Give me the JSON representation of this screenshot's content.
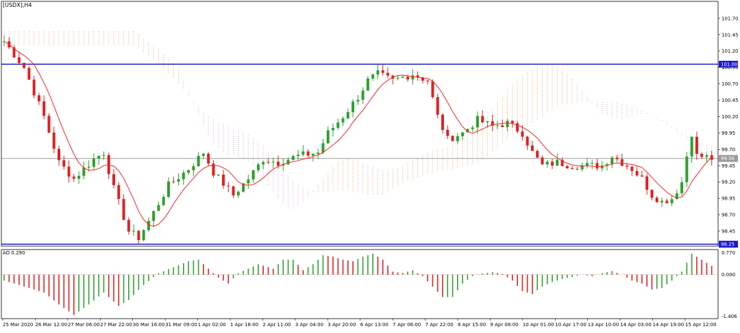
{
  "chart_data": {
    "type": "candlestick",
    "symbol_label": "[USDX],H4",
    "indicator_label": "AO 0.290",
    "price_axis": {
      "ticks": [
        "101.70",
        "101.45",
        "101.20",
        "100.95",
        "100.70",
        "100.45",
        "100.20",
        "99.95",
        "99.70",
        "99.45",
        "99.20",
        "98.95",
        "98.70",
        "98.45"
      ],
      "ylim": [
        98.22,
        101.96
      ]
    },
    "horizontal_levels": [
      {
        "value": 101.0,
        "label": "101.00",
        "color": "#1a1acc"
      },
      {
        "value": 98.25,
        "label": "98.25",
        "color": "#1a1acc"
      }
    ],
    "current_price": {
      "value": 99.56,
      "label": "99.56",
      "color": "#9a9a9a"
    },
    "ao_axis": {
      "ticks": [
        "0.770",
        "0.000",
        "-1.406"
      ],
      "ylim": [
        -1.406,
        0.77
      ]
    },
    "x_tick_labels": [
      "25 Mar 2020",
      "26 Mar 12:00",
      "27 Mar 06:00",
      "27 Mar 22:00",
      "30 Mar 16:00",
      "31 Mar 09:00",
      "1 Apr 02:00",
      "1 Apr 18:00",
      "2 Apr 11:00",
      "3 Apr 04:00",
      "3 Apr 20:00",
      "6 Apr 13:00",
      "7 Apr 06:00",
      "7 Apr 22:00",
      "8 Apr 15:00",
      "9 Apr 08:00",
      "10 Apr 01:00",
      "10 Apr 17:00",
      "13 Apr 10:00",
      "14 Apr 03:00",
      "14 Apr 19:00",
      "15 Apr 12:00"
    ],
    "close_path": [
      [
        0,
        101.35
      ],
      [
        4,
        100.95
      ],
      [
        8,
        100.2
      ],
      [
        11,
        99.5
      ],
      [
        14,
        99.25
      ],
      [
        18,
        99.55
      ],
      [
        20,
        99.65
      ],
      [
        22,
        99.1
      ],
      [
        25,
        98.45
      ],
      [
        27,
        98.35
      ],
      [
        29,
        98.6
      ],
      [
        33,
        99.15
      ],
      [
        37,
        99.4
      ],
      [
        40,
        99.65
      ],
      [
        42,
        99.35
      ],
      [
        46,
        99.0
      ],
      [
        49,
        99.25
      ],
      [
        52,
        99.55
      ],
      [
        55,
        99.5
      ],
      [
        59,
        99.6
      ],
      [
        63,
        99.65
      ],
      [
        65,
        99.95
      ],
      [
        68,
        100.2
      ],
      [
        71,
        100.5
      ],
      [
        73,
        100.75
      ],
      [
        75,
        100.85
      ],
      [
        78,
        100.75
      ],
      [
        82,
        100.85
      ],
      [
        85,
        100.75
      ],
      [
        87,
        100.2
      ],
      [
        89,
        99.85
      ],
      [
        92,
        99.95
      ],
      [
        95,
        100.15
      ],
      [
        98,
        100.05
      ],
      [
        101,
        100.1
      ],
      [
        104,
        99.95
      ],
      [
        106,
        99.65
      ],
      [
        108,
        99.45
      ],
      [
        111,
        99.5
      ],
      [
        114,
        99.45
      ],
      [
        117,
        99.45
      ],
      [
        120,
        99.45
      ],
      [
        122,
        99.6
      ],
      [
        124,
        99.5
      ],
      [
        126,
        99.4
      ],
      [
        128,
        99.25
      ],
      [
        130,
        99.0
      ],
      [
        132,
        98.9
      ],
      [
        134,
        98.95
      ],
      [
        136,
        99.2
      ],
      [
        137,
        99.6
      ],
      [
        138,
        99.95
      ],
      [
        139,
        99.6
      ],
      [
        141,
        99.58
      ],
      [
        142,
        99.56
      ]
    ],
    "ao_path": [
      [
        0,
        -0.2
      ],
      [
        8,
        -0.6
      ],
      [
        11,
        -1.0
      ],
      [
        14,
        -1.35
      ],
      [
        17,
        -1.0
      ],
      [
        20,
        -0.6
      ],
      [
        23,
        -1.05
      ],
      [
        25,
        -0.85
      ],
      [
        28,
        -0.35
      ],
      [
        31,
        0.05
      ],
      [
        34,
        0.25
      ],
      [
        37,
        0.45
      ],
      [
        39,
        0.5
      ],
      [
        41,
        0.2
      ],
      [
        43,
        -0.1
      ],
      [
        45,
        -0.3
      ],
      [
        47,
        0.05
      ],
      [
        49,
        0.2
      ],
      [
        51,
        0.35
      ],
      [
        54,
        0.2
      ],
      [
        56,
        0.5
      ],
      [
        58,
        0.5
      ],
      [
        60,
        0.15
      ],
      [
        62,
        0.35
      ],
      [
        64,
        0.65
      ],
      [
        66,
        0.6
      ],
      [
        68,
        0.5
      ],
      [
        70,
        0.45
      ],
      [
        72,
        0.6
      ],
      [
        74,
        0.7
      ],
      [
        76,
        0.5
      ],
      [
        78,
        0.1
      ],
      [
        80,
        0.05
      ],
      [
        82,
        0.15
      ],
      [
        84,
        -0.05
      ],
      [
        86,
        -0.4
      ],
      [
        88,
        -0.75
      ],
      [
        90,
        -0.75
      ],
      [
        92,
        -0.3
      ],
      [
        94,
        -0.05
      ],
      [
        96,
        0.04
      ],
      [
        98,
        0.08
      ],
      [
        100,
        0.02
      ],
      [
        102,
        -0.2
      ],
      [
        104,
        -0.55
      ],
      [
        106,
        -0.65
      ],
      [
        108,
        -0.4
      ],
      [
        110,
        -0.25
      ],
      [
        112,
        -0.15
      ],
      [
        114,
        -0.08
      ],
      [
        116,
        0.0
      ],
      [
        118,
        -0.05
      ],
      [
        120,
        0.05
      ],
      [
        122,
        0.12
      ],
      [
        124,
        0.0
      ],
      [
        126,
        -0.2
      ],
      [
        128,
        -0.3
      ],
      [
        130,
        -0.5
      ],
      [
        132,
        -0.45
      ],
      [
        134,
        -0.2
      ],
      [
        136,
        0.1
      ],
      [
        138,
        0.7
      ],
      [
        140,
        0.5
      ],
      [
        142,
        0.29
      ]
    ]
  }
}
